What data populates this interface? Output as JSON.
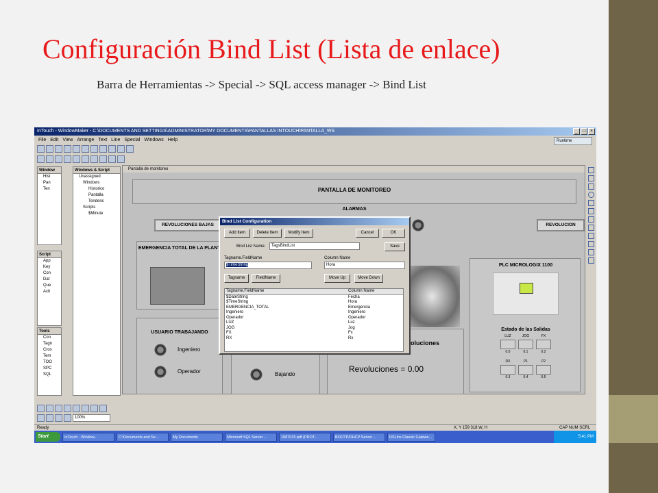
{
  "slide": {
    "title": "Configuración Bind List (Lista de enlace)",
    "subtitle": "Barra de Herramientas -> Special -> SQL access manager -> Bind List"
  },
  "window": {
    "title": "InTouch - WindowMaker - C:\\DOCUMENTS AND SETTINGS\\ADMINISTRATOR\\MY DOCUMENTS\\PANTALLAS INTOUCH\\PANTALLA_WS",
    "menu": [
      "File",
      "Edit",
      "View",
      "Arrange",
      "Text",
      "Line",
      "Special",
      "Windows",
      "Help"
    ],
    "runtime_label": "Runtime"
  },
  "windows_panel": {
    "header": "Windows & Script",
    "items": [
      "Unassigned",
      "Windows",
      "Historico",
      "Pantalla",
      "Tendenc",
      "Scripts",
      "$Minute"
    ]
  },
  "left_panels": {
    "windows_header": "Window",
    "windows_items": [
      "Hist",
      "Pan",
      "Ten"
    ],
    "scripts_header": "Script",
    "scripts_items": [
      "App",
      "Key",
      "Con",
      "Dat",
      "Que",
      "Acti"
    ],
    "tools_header": "Tools",
    "tools_items": [
      "Con",
      "Tagn",
      "Cros",
      "Tem",
      "TOO",
      "SPC",
      "SQL"
    ]
  },
  "canvas": {
    "tab": "Pantalla de monitoreo",
    "header": "PANTALLA DE MONITOREO",
    "alarmas": "ALARMAS",
    "rev_bajas": "REVOLUCIONES BAJAS",
    "rev_right": "REVOLUCION",
    "emergencia": "EMERGENCIA TOTAL DE LA PLANTA",
    "usuario": "USUARIO TRABAJANDO",
    "ingeniero": "Ingeniero",
    "operador": "Operador",
    "bajando": "Bajando",
    "revoluciones_label": "oluciones",
    "revoluciones_value": "Revoluciones = 0.00",
    "plc_title": "PLC MICROLOGIX 1100",
    "salidas": "Estado de las Salidas",
    "outputs_row1": [
      {
        "name": "LUZ",
        "val": "0.0"
      },
      {
        "name": "JOG",
        "val": "0.1"
      },
      {
        "name": "FX",
        "val": "0.2"
      }
    ],
    "outputs_row2": [
      {
        "name": "RX",
        "val": "0.3"
      },
      {
        "name": "P1",
        "val": "0.4"
      },
      {
        "name": "P2",
        "val": "0.5"
      }
    ]
  },
  "dialog": {
    "title": "Bind List Configuration",
    "add_item": "Add Item",
    "delete_item": "Delete Item",
    "modify_item": "Modify Item",
    "cancel": "Cancel",
    "ok": "OK",
    "bind_list_name_label": "Bind List Name:",
    "bind_list_name_value": "TagsBindList",
    "save": "Save",
    "tagname_field_label": "Tagname.FieldName",
    "tagname_field_value": "$TimeString",
    "column_name_label": "Column Name",
    "column_name_value": "Hora",
    "tagname_btn": "Tagname",
    "fieldname_btn": "FieldName",
    "move_up": "Move Up",
    "move_down": "Move Down",
    "list_header": [
      "Tagname.FieldName",
      "Column Name"
    ],
    "rows": [
      [
        "$DateString",
        "Fecha"
      ],
      [
        "$TimeString",
        "Hora"
      ],
      [
        "EMERGENCIA_TOTAL",
        "Emergencia"
      ],
      [
        "Ingeniero",
        "Ingeniero"
      ],
      [
        "Operador",
        "Operador"
      ],
      [
        "LUZ",
        "Luz"
      ],
      [
        "JOG",
        "Jog"
      ],
      [
        "FX",
        "Fx"
      ],
      [
        "RX",
        "Rx"
      ]
    ]
  },
  "statusbar": {
    "ready": "Ready",
    "coords": "X, Y 159    318    W, H",
    "indicators": "CAP  NUM  SCRL"
  },
  "taskbar": {
    "start": "Start",
    "tasks": [
      "InTouch - Window...",
      "C:\\Documents and Se...",
      "My Documents",
      "Microsoft SQL Server ...",
      "1087015.pdf (PROT...",
      "BOOTP/DHCP Server ...",
      "RSLinx Classic Gatewa..."
    ],
    "clock": "5:41 PM"
  },
  "zoom": "100%"
}
